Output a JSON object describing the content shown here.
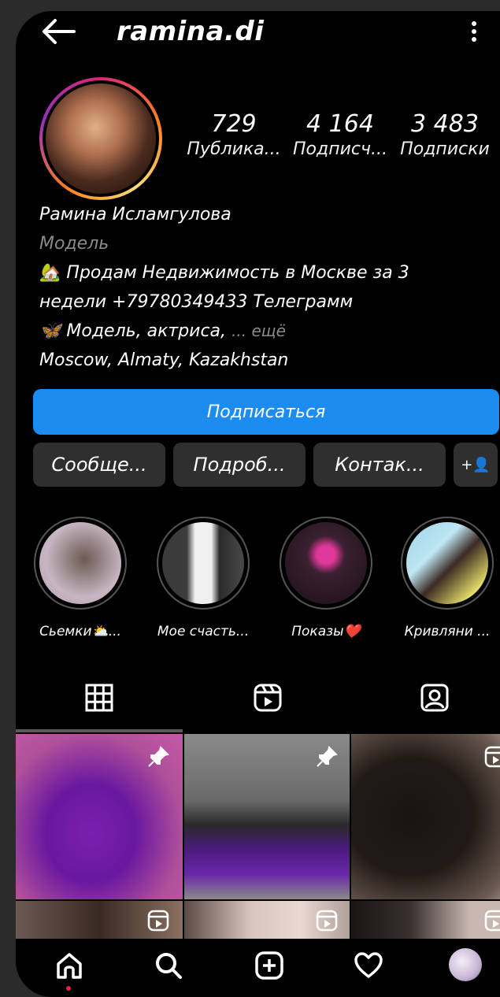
{
  "header": {
    "username": "ramina.di"
  },
  "stats": [
    {
      "value": "729",
      "label": "Публика..."
    },
    {
      "value": "4 164",
      "label": "Подписч..."
    },
    {
      "value": "3 483",
      "label": "Подписки"
    }
  ],
  "bio": {
    "name": "Рамина Исламгулова",
    "category": "Модель",
    "line1_emoji": "🏡",
    "line1": "Продам Недвижимость в Москве за 3",
    "line2": "недели +79780349433 Телеграмм",
    "line3_emoji": "🦋",
    "line3": "Модель, актриса,",
    "more": "... ещё",
    "location": "Moscow, Almaty, Kazakhstan"
  },
  "actions": {
    "follow": "Подписаться",
    "message": "Сообще...",
    "details": "Подроб...",
    "contacts": "Контак...",
    "add_user_glyph": "+👤"
  },
  "highlights": [
    {
      "label": "Сьемки⛅..."
    },
    {
      "label": "Мое счасть..."
    },
    {
      "label": "Показы❤️"
    },
    {
      "label": "Кривляни ..."
    }
  ],
  "tabs": [
    "grid-icon",
    "reels-icon",
    "tagged-icon"
  ],
  "bottom_nav": [
    "home-icon",
    "search-icon",
    "create-icon",
    "heart-icon",
    "profile-avatar"
  ],
  "colors": {
    "accent": "#1c8cf0",
    "background": "#000000",
    "button": "#2f2f2f"
  }
}
